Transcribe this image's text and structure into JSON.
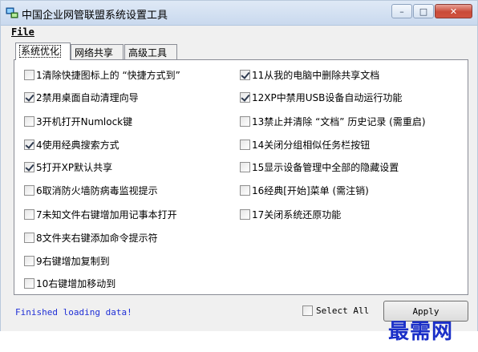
{
  "window": {
    "title": "中国企业网管联盟系统设置工具",
    "controls": {
      "minimize": "–",
      "maximize": "□",
      "close": "✕"
    }
  },
  "menu": {
    "file": "File"
  },
  "tabs": [
    {
      "label": "系统优化",
      "active": true
    },
    {
      "label": "网络共享",
      "active": false
    },
    {
      "label": "高级工具",
      "active": false
    }
  ],
  "options": {
    "left": [
      {
        "label": "1清除快捷图标上的 “快捷方式到”",
        "checked": false
      },
      {
        "label": "2禁用桌面自动清理向导",
        "checked": true
      },
      {
        "label": "3开机打开Numlock键",
        "checked": false
      },
      {
        "label": "4使用经典搜索方式",
        "checked": true
      },
      {
        "label": "5打开XP默认共享",
        "checked": true
      },
      {
        "label": "6取消防火墙防病毒监视提示",
        "checked": false
      },
      {
        "label": "7未知文件右键增加用记事本打开",
        "checked": false
      },
      {
        "label": "8文件夹右键添加命令提示符",
        "checked": false
      },
      {
        "label": "9右键增加复制到",
        "checked": false
      },
      {
        "label": "10右键增加移动到",
        "checked": false
      }
    ],
    "right": [
      {
        "label": "11从我的电脑中删除共享文档",
        "checked": true
      },
      {
        "label": "12XP中禁用USB设备自动运行功能",
        "checked": true
      },
      {
        "label": "13禁止并清除 “文档” 历史记录 (需重启)",
        "checked": false
      },
      {
        "label": "14关闭分组相似任务栏按钮",
        "checked": false
      },
      {
        "label": "15显示设备管理中全部的隐藏设置",
        "checked": false
      },
      {
        "label": "16经典[开始]菜单 (需注销)",
        "checked": false
      },
      {
        "label": "17关闭系统还原功能",
        "checked": false
      }
    ]
  },
  "status": "Finished loading data!",
  "select_all": {
    "label": "Select All",
    "checked": false
  },
  "apply_label": "Apply",
  "watermark": "最需网",
  "colors": {
    "status_text": "#1f2fd6",
    "watermark": "#1a2fc8",
    "title_bar": "#dfe9f6"
  },
  "icons": {
    "app": "computer-network-icon"
  }
}
